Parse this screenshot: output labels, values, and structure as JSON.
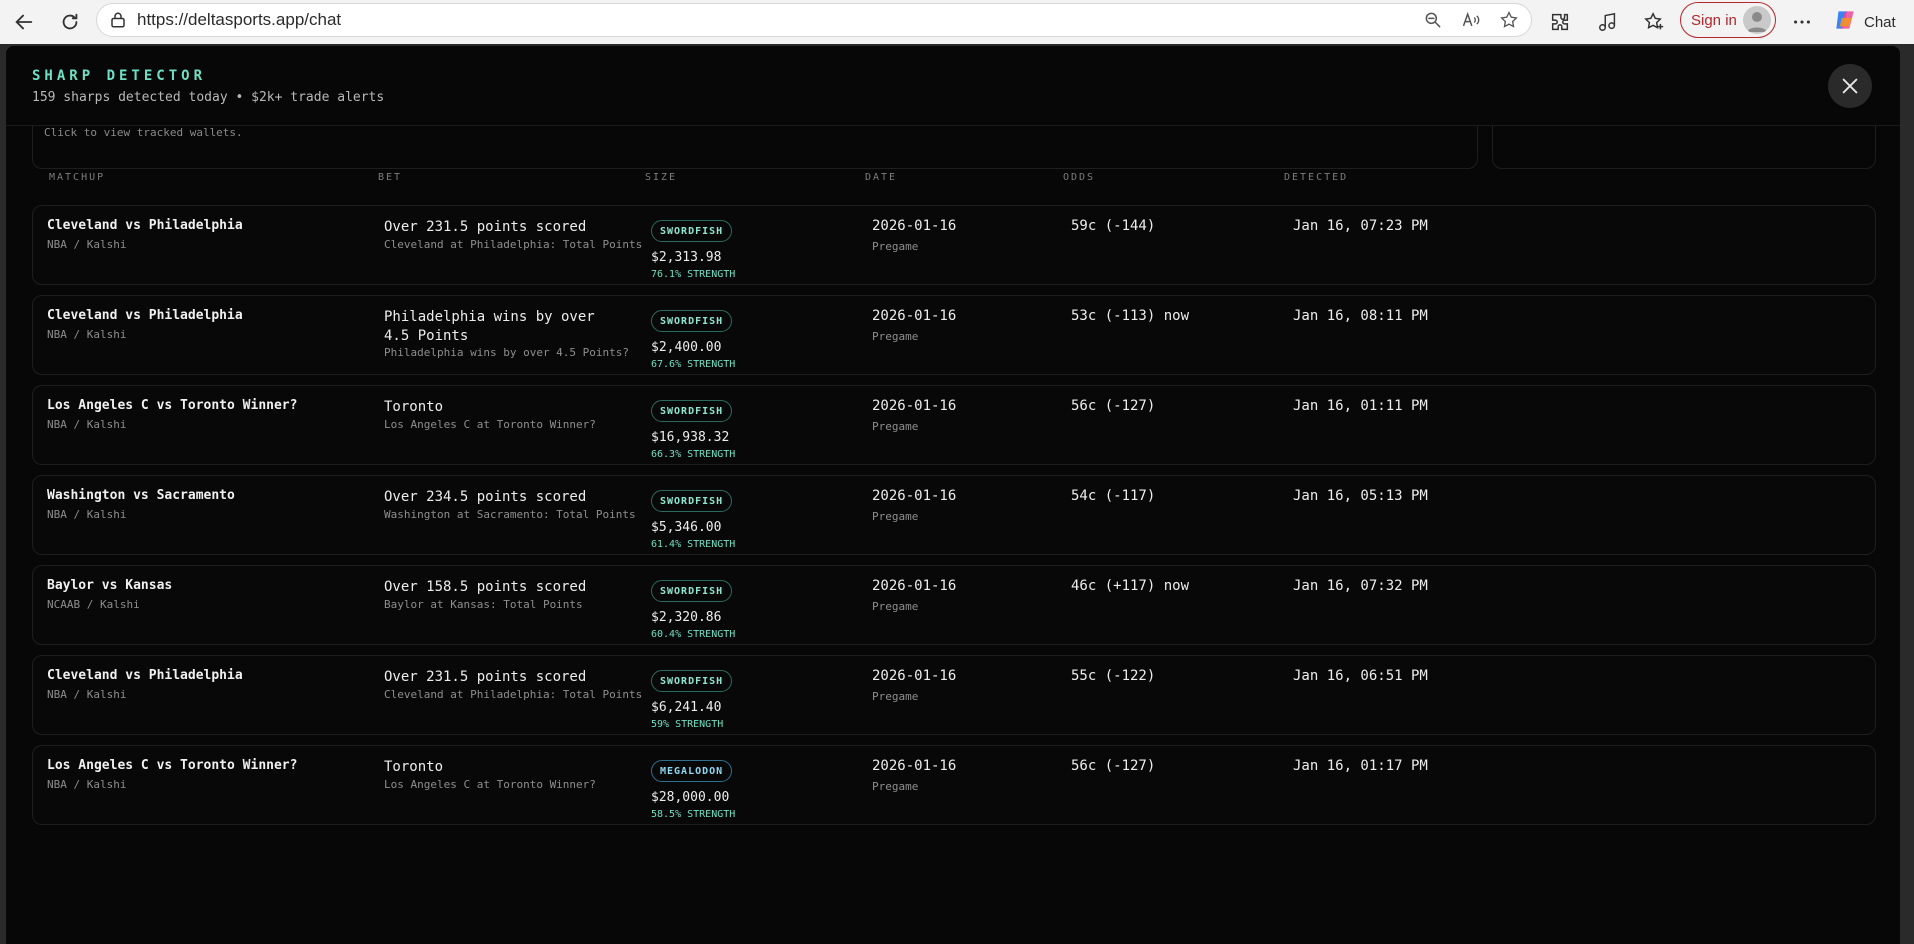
{
  "browser": {
    "url": "https://deltasports.app/chat",
    "sign_in_label": "Sign in",
    "copilot_label": "Chat"
  },
  "modal": {
    "title": "SHARP DETECTOR",
    "subtitle": "159 sharps detected today • $2k+ trade alerts",
    "tracked_note": "Click to view tracked wallets."
  },
  "columns": {
    "matchup": "MATCHUP",
    "bet": "BET",
    "size": "SIZE",
    "date": "DATE",
    "odds": "ODDS",
    "detected": "DETECTED"
  },
  "rows": [
    {
      "matchup": "Cleveland vs Philadelphia",
      "league": "NBA / Kalshi",
      "bet": "Over 231.5 points scored",
      "bet_desc": "Cleveland at Philadelphia: Total Points",
      "tier": "SWORDFISH",
      "size": "$2,313.98",
      "strength": "76.1% STRENGTH",
      "date": "2026-01-16",
      "status": "Pregame",
      "odds": "59c (-144)",
      "detected": "Jan 16, 07:23 PM"
    },
    {
      "matchup": "Cleveland vs Philadelphia",
      "league": "NBA / Kalshi",
      "bet": "Philadelphia wins by over 4.5 Points",
      "bet_desc": "Philadelphia wins by over 4.5 Points?",
      "tier": "SWORDFISH",
      "size": "$2,400.00",
      "strength": "67.6% STRENGTH",
      "date": "2026-01-16",
      "status": "Pregame",
      "odds": "53c (-113) now",
      "detected": "Jan 16, 08:11 PM"
    },
    {
      "matchup": "Los Angeles C vs Toronto Winner?",
      "league": "NBA / Kalshi",
      "bet": "Toronto",
      "bet_desc": "Los Angeles C at Toronto Winner?",
      "tier": "SWORDFISH",
      "size": "$16,938.32",
      "strength": "66.3% STRENGTH",
      "date": "2026-01-16",
      "status": "Pregame",
      "odds": "56c (-127)",
      "detected": "Jan 16, 01:11 PM"
    },
    {
      "matchup": "Washington vs Sacramento",
      "league": "NBA / Kalshi",
      "bet": "Over 234.5 points scored",
      "bet_desc": "Washington at Sacramento: Total Points",
      "tier": "SWORDFISH",
      "size": "$5,346.00",
      "strength": "61.4% STRENGTH",
      "date": "2026-01-16",
      "status": "Pregame",
      "odds": "54c (-117)",
      "detected": "Jan 16, 05:13 PM"
    },
    {
      "matchup": "Baylor vs Kansas",
      "league": "NCAAB / Kalshi",
      "bet": "Over 158.5 points scored",
      "bet_desc": "Baylor at Kansas: Total Points",
      "tier": "SWORDFISH",
      "size": "$2,320.86",
      "strength": "60.4% STRENGTH",
      "date": "2026-01-16",
      "status": "Pregame",
      "odds": "46c (+117) now",
      "detected": "Jan 16, 07:32 PM"
    },
    {
      "matchup": "Cleveland vs Philadelphia",
      "league": "NBA / Kalshi",
      "bet": "Over 231.5 points scored",
      "bet_desc": "Cleveland at Philadelphia: Total Points",
      "tier": "SWORDFISH",
      "size": "$6,241.40",
      "strength": "59% STRENGTH",
      "date": "2026-01-16",
      "status": "Pregame",
      "odds": "55c (-122)",
      "detected": "Jan 16, 06:51 PM"
    },
    {
      "matchup": "Los Angeles C vs Toronto Winner?",
      "league": "NBA / Kalshi",
      "bet": "Toronto",
      "bet_desc": "Los Angeles C at Toronto Winner?",
      "tier": "MEGALODON",
      "size": "$28,000.00",
      "strength": "58.5% STRENGTH",
      "date": "2026-01-16",
      "status": "Pregame",
      "odds": "56c (-127)",
      "detected": "Jan 16, 01:17 PM"
    }
  ]
}
